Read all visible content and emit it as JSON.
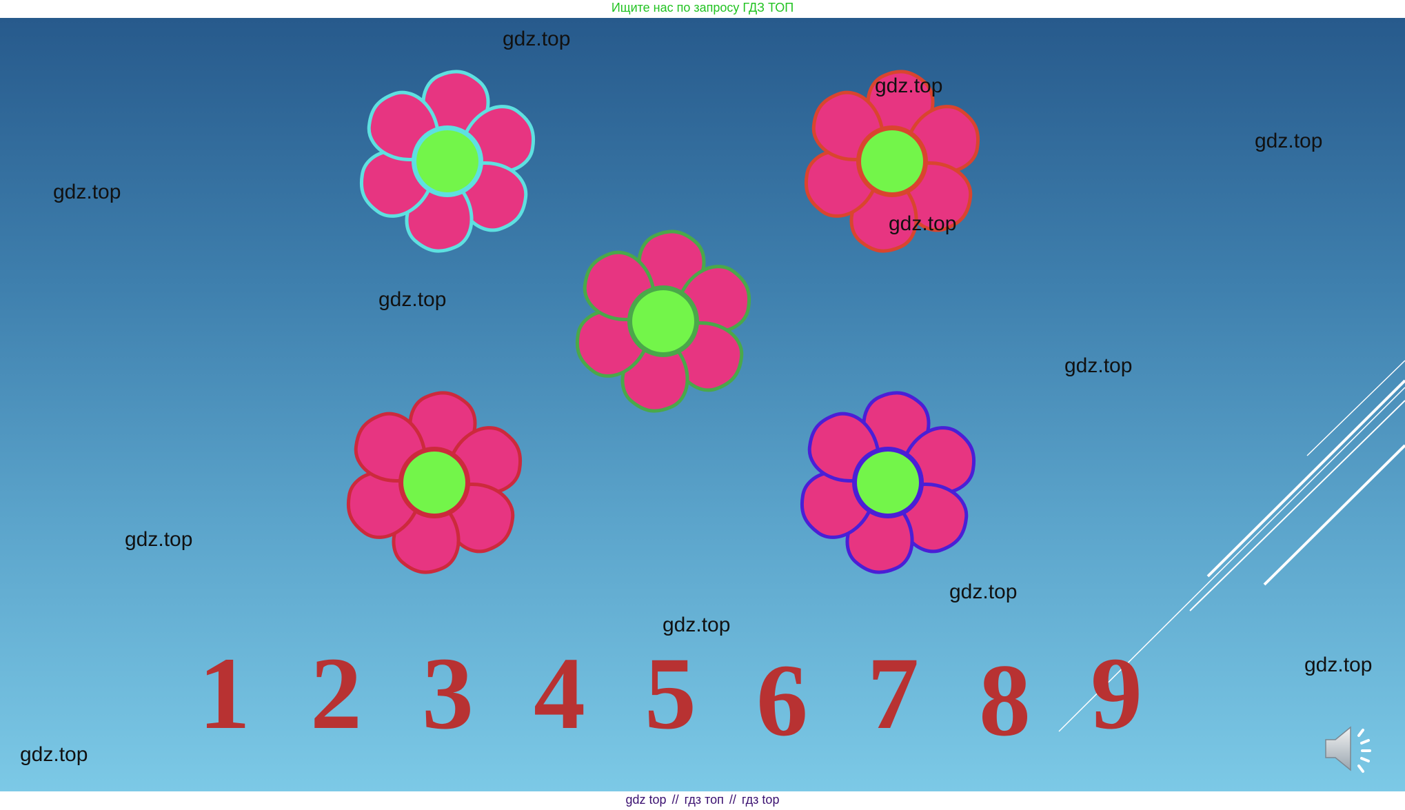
{
  "top_banner": "Ищите нас по запросу ГДЗ ТОП",
  "bottom_banner": {
    "parts": [
      "gdz top",
      "гдз топ",
      "гдз top"
    ],
    "separator": "//"
  },
  "watermark_text": "gdz.top",
  "flowers": [
    {
      "outline_color": "#5ee0e0",
      "petal_color": "#e73581",
      "center_color": "#73f54a"
    },
    {
      "outline_color": "#d9452e",
      "petal_color": "#e73581",
      "center_color": "#73f54a"
    },
    {
      "outline_color": "#4aa84a",
      "petal_color": "#e73581",
      "center_color": "#73f54a"
    },
    {
      "outline_color": "#cc2a3c",
      "petal_color": "#e73581",
      "center_color": "#73f54a"
    },
    {
      "outline_color": "#4a1fd6",
      "petal_color": "#e73581",
      "center_color": "#73f54a"
    }
  ],
  "digits": [
    "1",
    "2",
    "3",
    "4",
    "5",
    "6",
    "7",
    "8",
    "9"
  ],
  "colors": {
    "digit": "#b83232",
    "slide_top": "#275a8c",
    "slide_bottom": "#7cc9e6"
  },
  "icons": {
    "audio": "speaker-icon"
  }
}
